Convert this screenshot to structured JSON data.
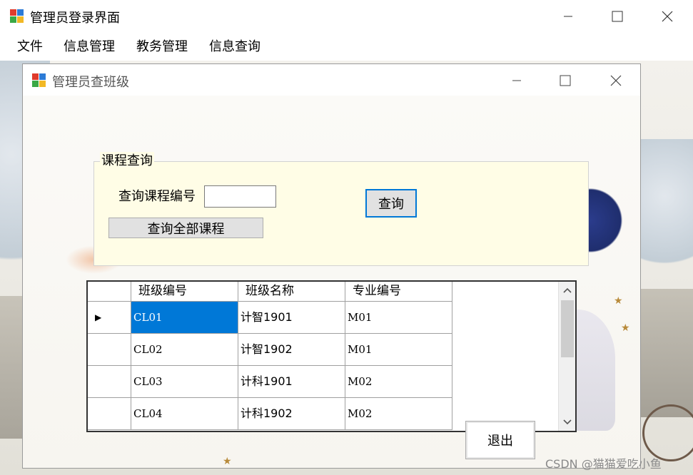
{
  "outer_window": {
    "title": "管理员登录界面",
    "menu": [
      "文件",
      "信息管理",
      "教务管理",
      "信息查询"
    ]
  },
  "inner_window": {
    "title": "管理员查班级"
  },
  "groupbox": {
    "title": "课程查询",
    "course_id_label": "查询课程编号",
    "course_id_value": "",
    "query_button": "查询",
    "query_all_button": "查询全部课程"
  },
  "grid": {
    "columns": [
      "班级编号",
      "班级名称",
      "专业编号"
    ],
    "rows": [
      [
        "CL01",
        "计智1901",
        "M01"
      ],
      [
        "CL02",
        "计智1902",
        "M01"
      ],
      [
        "CL03",
        "计科1901",
        "M02"
      ],
      [
        "CL04",
        "计科1902",
        "M02"
      ]
    ],
    "current_row_marker": "▶"
  },
  "exit_button": "退出",
  "watermark": "CSDN @猫猫爱吃小鱼",
  "colors": {
    "selection": "#0078d7",
    "groupbox_bg": "#fffde6",
    "focus_border": "#0078d7"
  }
}
